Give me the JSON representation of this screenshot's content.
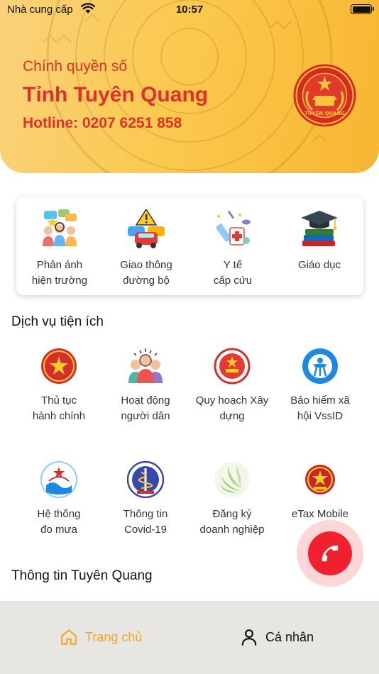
{
  "status_bar": {
    "carrier": "Nhà cung cấp",
    "time": "10:57",
    "wifi_icon": "wifi-icon",
    "battery_icon": "battery-icon",
    "battery_level": 1.0
  },
  "header": {
    "subtitle": "Chính quyền số",
    "title": "Tỉnh Tuyên Quang",
    "hotline": "Hotline: 0207 6251 858",
    "emblem_text": "TUYÊN QUANG"
  },
  "quick_actions": [
    {
      "line1": "Phản ánh",
      "line2": "hiện trường",
      "icon": "community-feedback-icon"
    },
    {
      "line1": "Giao thông",
      "line2": "đường bộ",
      "icon": "traffic-warning-icon"
    },
    {
      "line1": "Y tế",
      "line2": "cấp cứu",
      "icon": "medical-syringe-icon"
    },
    {
      "line1": "Giáo dục",
      "line2": "",
      "icon": "graduation-cap-icon"
    }
  ],
  "services": {
    "title": "Dịch vụ tiện ích",
    "items": [
      {
        "line1": "Thủ tục",
        "line2": "hành chính",
        "icon": "national-emblem-icon"
      },
      {
        "line1": "Hoạt động",
        "line2": "người dân",
        "icon": "people-group-icon"
      },
      {
        "line1": "Quy hoạch Xây",
        "line2": "dựng",
        "icon": "province-seal-icon"
      },
      {
        "line1": "Bảo hiểm xã",
        "line2": "hội VssID",
        "icon": "social-insurance-icon"
      },
      {
        "line1": "Hệ thống",
        "line2": "đo mưa",
        "icon": "rain-monitor-icon"
      },
      {
        "line1": "Thông tin",
        "line2": "Covid-19",
        "icon": "health-ministry-icon"
      },
      {
        "line1": "Đăng ký",
        "line2": "doanh nghiệp",
        "icon": "leaf-business-icon"
      },
      {
        "line1": "eTax Mobile",
        "line2": "",
        "icon": "tax-emblem-icon"
      }
    ]
  },
  "info_section": {
    "title": "Thông tin Tuyên Quang"
  },
  "call_button": {
    "icon": "phone-icon"
  },
  "bottom_nav": {
    "home": {
      "label": "Trang chủ",
      "icon": "home-icon"
    },
    "profile": {
      "label": "Cá nhân",
      "icon": "user-icon"
    }
  },
  "colors": {
    "accent": "#e0302a",
    "banner": "#fbc94f",
    "active_nav": "#f5a81e",
    "call": "#f0202e"
  }
}
